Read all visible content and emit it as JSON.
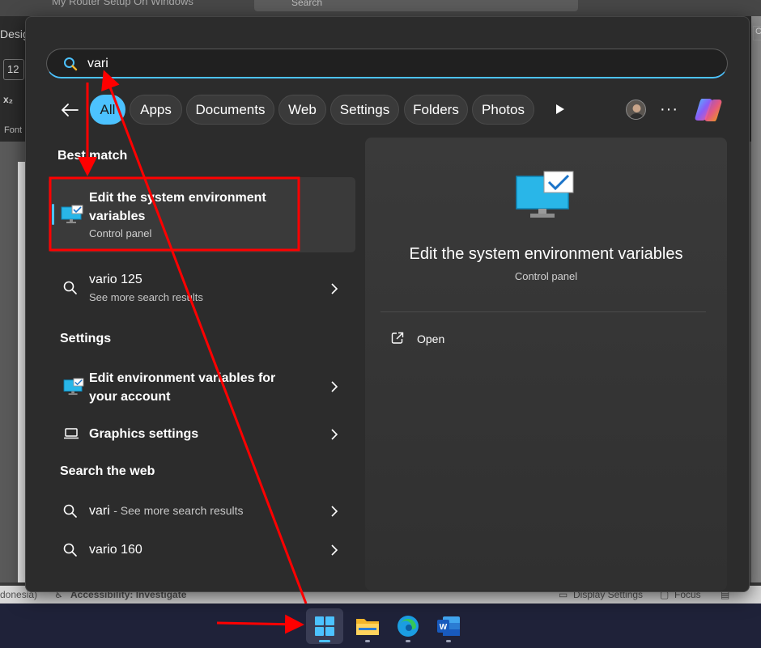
{
  "background_window": {
    "title": "My Router Setup On Windows",
    "search_placeholder": "Search",
    "ribbon_tab": "Desig",
    "font_size": "12",
    "subscript": "x₂",
    "font_group": "Font",
    "right_edge_label": "C",
    "status_left": "donesia)",
    "status_accessibility": "Accessibility: Investigate",
    "status_display": "Display Settings",
    "status_focus": "Focus"
  },
  "search": {
    "query": "vari"
  },
  "filters": [
    "All",
    "Apps",
    "Documents",
    "Web",
    "Settings",
    "Folders",
    "Photos"
  ],
  "toolbar": {
    "more_label": "···"
  },
  "sections": {
    "best_match": "Best match",
    "settings": "Settings",
    "search_web": "Search the web"
  },
  "best_match": {
    "title": "Edit the system environment variables",
    "subtitle": "Control panel"
  },
  "results": {
    "vario125_title": "vario 125",
    "vario125_sub": "See more search results",
    "env_account": "Edit environment variables for your account",
    "graphics": "Graphics settings",
    "web_vari": "vari",
    "web_vari_sub": "- See more search results",
    "web_vario160": "vario 160"
  },
  "preview": {
    "title": "Edit the system environment variables",
    "subtitle": "Control panel",
    "open_label": "Open"
  },
  "taskbar": {
    "apps": [
      "start",
      "file-explorer",
      "edge",
      "word"
    ]
  },
  "colors": {
    "accent": "#4cc2ff",
    "annotation": "#ff0000",
    "taskbar": "#1f2239"
  }
}
